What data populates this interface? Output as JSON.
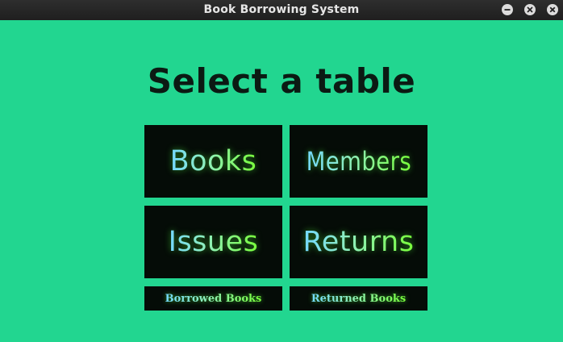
{
  "window": {
    "title": "Book Borrowing System"
  },
  "heading": "Select a table",
  "tiles": [
    {
      "label": "Books"
    },
    {
      "label": "Members"
    },
    {
      "label": "Issues"
    },
    {
      "label": "Returns"
    },
    {
      "label": "Borrowed Books"
    },
    {
      "label": "Returned Books"
    }
  ],
  "colors": {
    "background": "#22d690",
    "tile": "#050c07",
    "heading_text": "#0b1a13",
    "label_gradient_start": "#74d8ff",
    "label_gradient_end": "#79ff3a"
  },
  "icons": {
    "minimize": "minimize-icon",
    "maximize": "maximize-icon",
    "close": "close-icon"
  }
}
